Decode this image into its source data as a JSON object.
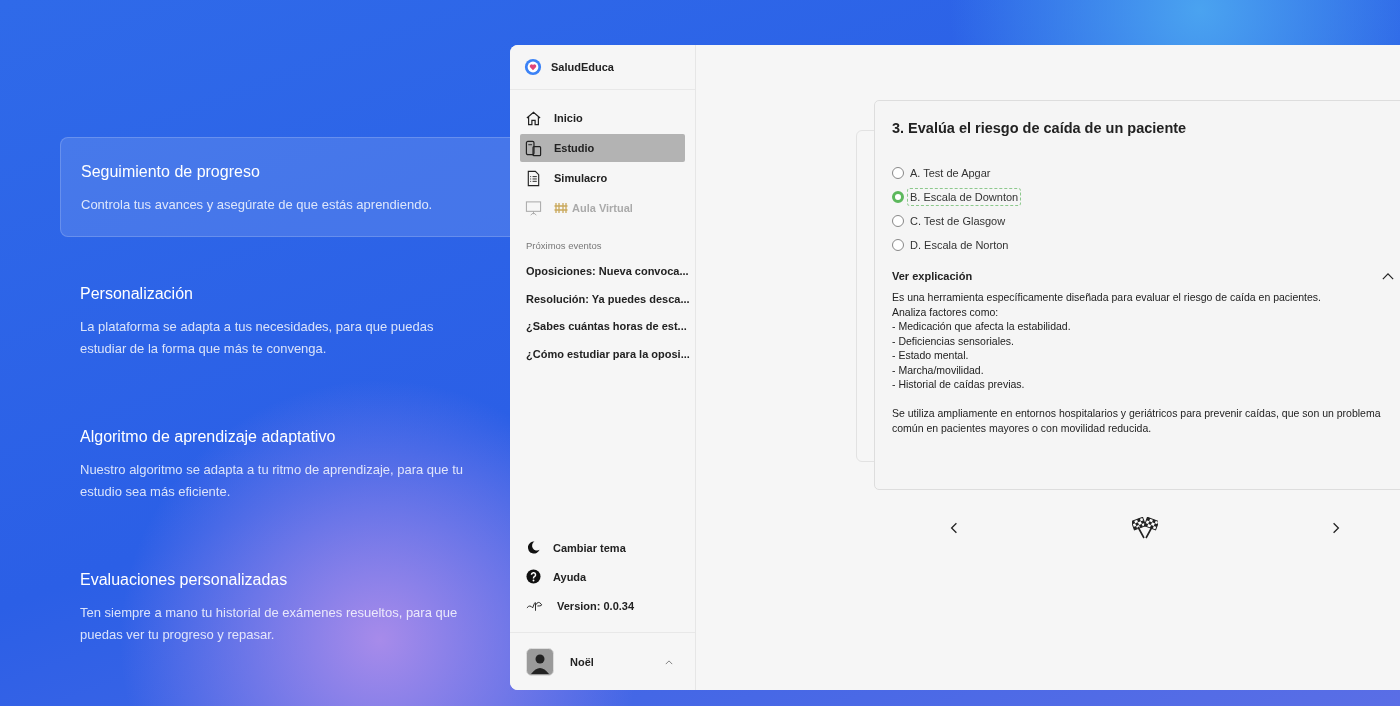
{
  "features": [
    {
      "title": "Seguimiento de progreso",
      "text": "Controla tus avances y asegúrate de que estás aprendiendo.",
      "selected": true
    },
    {
      "title": "Personalización",
      "text": "La plataforma se adapta a tus necesidades, para que puedas estudiar de la forma que más te convenga.",
      "selected": false
    },
    {
      "title": "Algoritmo de aprendizaje adaptativo",
      "text": "Nuestro algoritmo se adapta a tu ritmo de aprendizaje, para que tu estudio sea más eficiente.",
      "selected": false
    },
    {
      "title": "Evaluaciones personalizadas",
      "text": "Ten siempre a mano tu historial de exámenes resueltos, para que puedas ver tu progreso y repasar.",
      "selected": false
    }
  ],
  "app": {
    "brand": "SaludEduca",
    "nav": [
      {
        "kind": "home",
        "label": "Inicio",
        "selected": false,
        "disabled": false
      },
      {
        "kind": "study",
        "label": "Estudio",
        "selected": true,
        "disabled": false
      },
      {
        "kind": "exam",
        "label": "Simulacro",
        "selected": false,
        "disabled": false
      },
      {
        "kind": "classroom",
        "label": "Aula Virtual",
        "selected": false,
        "disabled": true
      }
    ],
    "events_heading": "Próximos eventos",
    "events": [
      "Oposiciones: Nueva convoca...",
      "Resolución: Ya puedes desca...",
      "¿Sabes cuántas horas de est...",
      "¿Cómo estudiar para la oposi..."
    ],
    "footer_items": [
      {
        "kind": "theme",
        "label": "Cambiar tema"
      },
      {
        "kind": "help",
        "label": "Ayuda"
      },
      {
        "kind": "version",
        "label": "Version: 0.0.34"
      }
    ],
    "user": {
      "name": "Noël",
      "expanded": false
    }
  },
  "question": {
    "title": "3. Evalúa el riesgo de caída de un paciente",
    "options": [
      {
        "label": "A. Test de Apgar",
        "selected": false
      },
      {
        "label": "B. Escala de Downton",
        "selected": true
      },
      {
        "label": "C. Test de Glasgow",
        "selected": false
      },
      {
        "label": "D. Escala de Norton",
        "selected": false
      }
    ],
    "explanation_heading": "Ver explicación",
    "explanation_expanded": true,
    "explanation": "Es una herramienta específicamente diseñada para evaluar el riesgo de caída en pacientes.\nAnaliza factores como:\n- Medicación que afecta la estabilidad.\n- Deficiencias sensoriales.\n- Estado mental.\n- Marcha/movilidad.\n- Historial de caídas previas.\n\nSe utiliza ampliamente en entornos hospitalarios y geriátricos para prevenir caídas, que son un problema común en pacientes mayores o con movilidad reducida."
  }
}
